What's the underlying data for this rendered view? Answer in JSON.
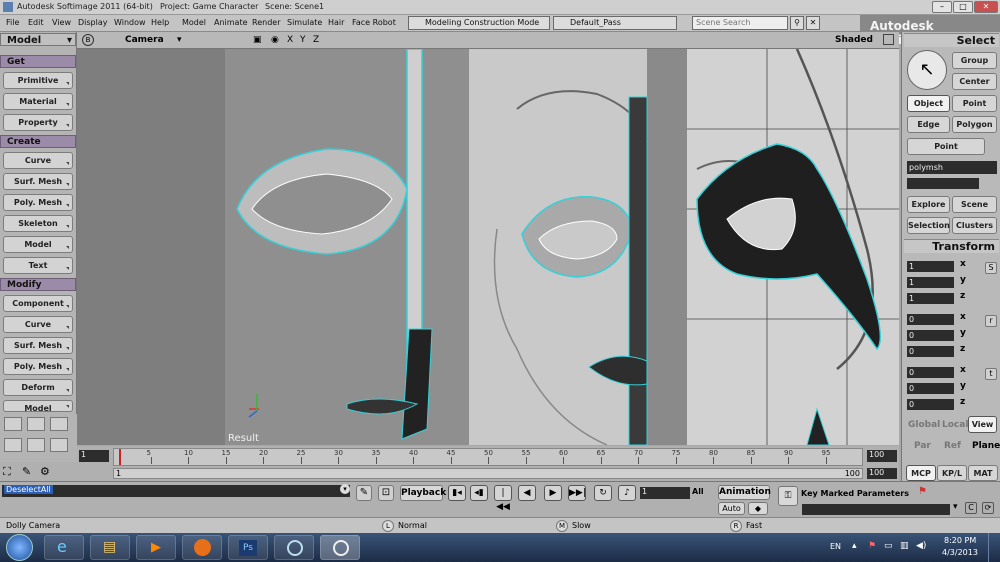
{
  "window": {
    "title": "Autodesk Softimage 2011 (64-bit)",
    "project": "Project: Game Character",
    "scene": "Scene: Scene1"
  },
  "menu": [
    "File",
    "Edit",
    "View",
    "Display",
    "Window",
    "Help",
    "Model",
    "Animate",
    "Render",
    "Simulate",
    "Hair",
    "Face Robot"
  ],
  "mode_combo": "Modeling Construction Mode",
  "pass_combo": "Default_Pass",
  "search_placeholder": "Scene Search",
  "brand": "Autodesk Softimage",
  "left_panel": {
    "module": "Model",
    "sections": [
      {
        "title": "Get",
        "items": [
          "Primitive",
          "Material",
          "Property"
        ]
      },
      {
        "title": "Create",
        "items": [
          "Curve",
          "Surf. Mesh",
          "Poly. Mesh",
          "Skeleton",
          "Model",
          "Text"
        ]
      },
      {
        "title": "Modify",
        "items": [
          "Component",
          "Curve",
          "Surf. Mesh",
          "Poly. Mesh",
          "Deform",
          "Model"
        ]
      }
    ]
  },
  "viewport": {
    "camera": "Camera",
    "axes": [
      "X",
      "Y",
      "Z"
    ],
    "shading": "Shaded",
    "result": "Result"
  },
  "right_panel": {
    "select_title": "Select",
    "buttons": [
      "Group",
      "Center",
      "Object",
      "Point",
      "Edge",
      "Polygon",
      "Point"
    ],
    "selected": "Object",
    "object_name": "polymsh",
    "explore": [
      "Explore",
      "Scene",
      "Selection",
      "Clusters"
    ],
    "transform_title": "Transform",
    "scale": [
      "1",
      "1",
      "1"
    ],
    "rotate": [
      "0",
      "0",
      "0"
    ],
    "translate": [
      "0",
      "0",
      "0"
    ],
    "axes": [
      "x",
      "y",
      "z"
    ],
    "locks": [
      "S",
      "r",
      "t"
    ],
    "ref": [
      "Global",
      "Local",
      "View",
      "Par",
      "Ref",
      "Plane"
    ],
    "tabs": [
      "MCP",
      "KP/L",
      "MAT"
    ]
  },
  "timeline": {
    "start": "1",
    "current": "1",
    "ticks": [
      "5",
      "10",
      "15",
      "20",
      "25",
      "30",
      "35",
      "40",
      "45",
      "50",
      "55",
      "60",
      "65",
      "70",
      "75",
      "80",
      "85",
      "90",
      "95"
    ],
    "end": "100",
    "end2": "100",
    "end3": "100"
  },
  "bottom": {
    "command": "DeselectAll",
    "playback": "Playback",
    "frame": "1",
    "all": "All",
    "animation": "Animation",
    "auto": "Auto",
    "key_marked": "Key Marked Parameters"
  },
  "status": {
    "left": "Dolly Camera",
    "L": "Normal",
    "M": "Slow",
    "R": "Fast"
  },
  "taskbar": {
    "lang": "EN",
    "time": "8:20 PM",
    "date": "4/3/2013"
  }
}
